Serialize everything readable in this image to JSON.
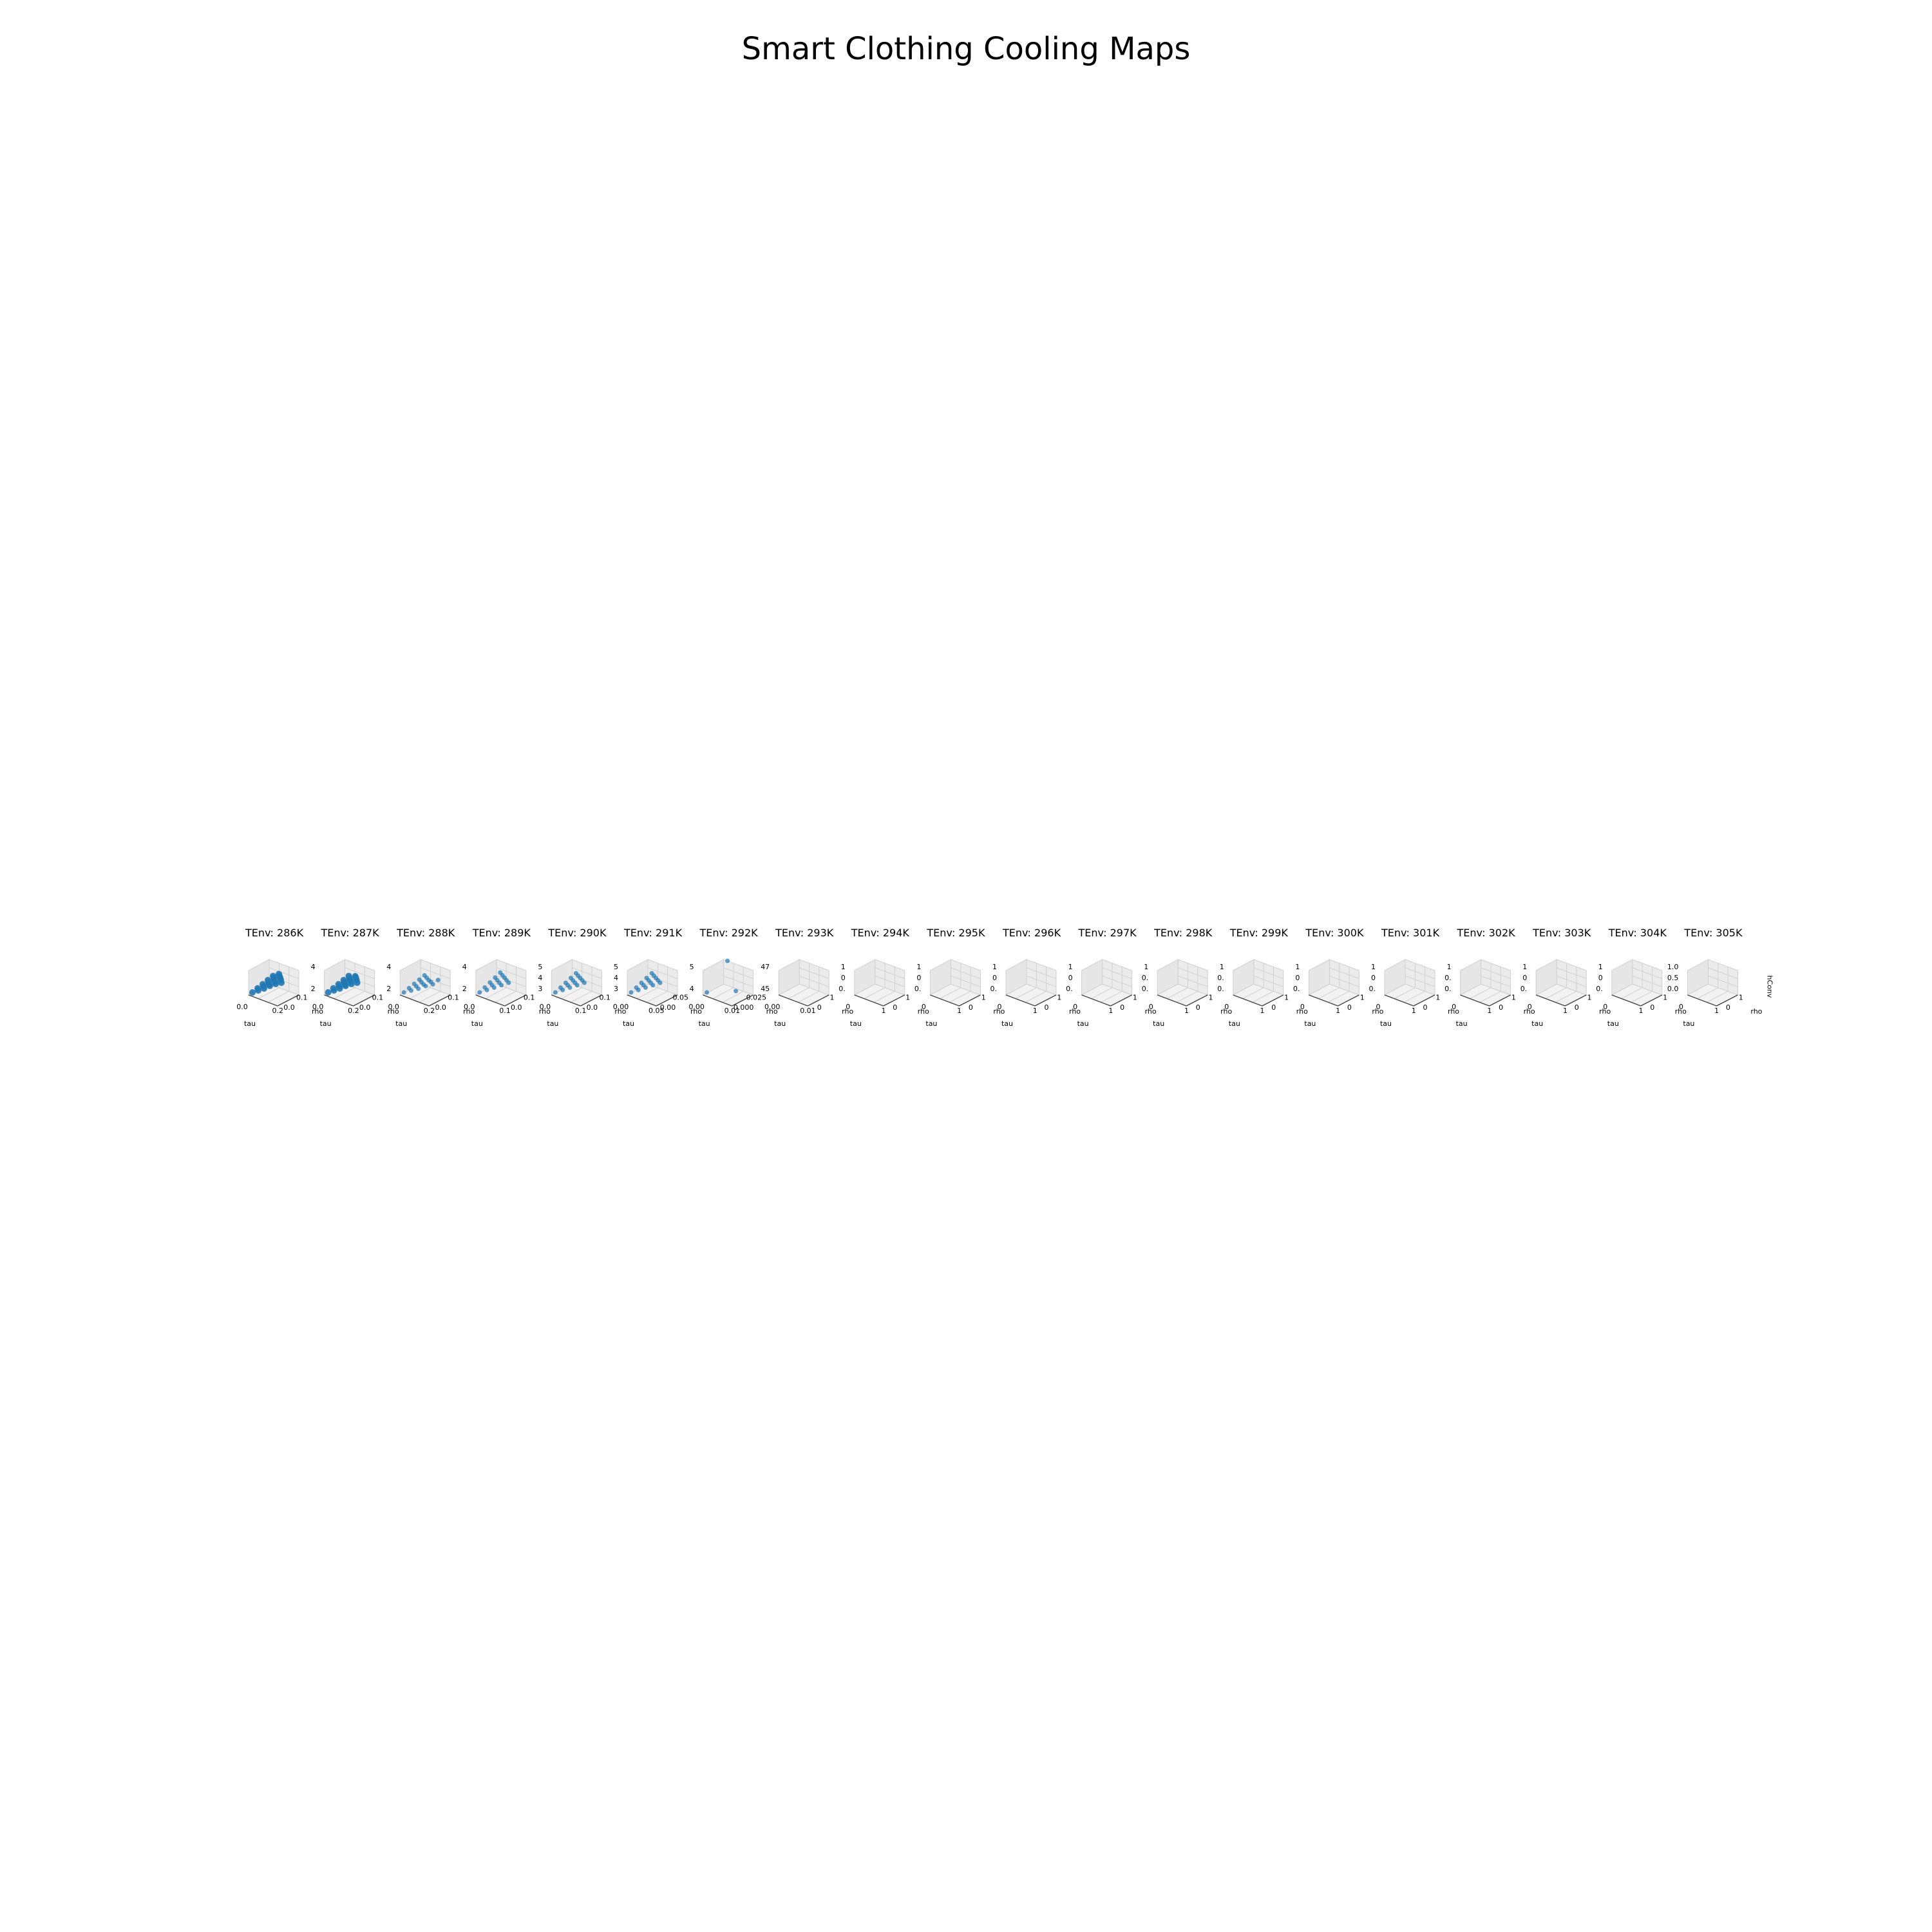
{
  "figure": {
    "title": "Smart Clothing Cooling Maps"
  },
  "style": {
    "point_color": "#1f77b4",
    "pane_color": "#f2f2f2",
    "grid_color": "#d0d0d0"
  },
  "chart_data": [
    {
      "type": "scatter3d",
      "title": "TEnv: 286K",
      "xlabel": "tau",
      "ylabel": "rho",
      "zlabel": "",
      "x_ticks": [
        "0.0",
        "0.2"
      ],
      "y_ticks": [
        "0.0",
        "0.1"
      ],
      "z_ticks": [],
      "has_data": true,
      "points": [
        [
          0.0,
          0.0,
          2.0
        ],
        [
          0.05,
          0.0,
          2.6
        ],
        [
          0.1,
          0.0,
          3.2
        ],
        [
          0.15,
          0.0,
          3.9
        ],
        [
          0.2,
          0.0,
          4.5
        ],
        [
          0.25,
          0.0,
          5.0
        ],
        [
          0.0,
          0.03,
          2.2
        ],
        [
          0.05,
          0.03,
          2.8
        ],
        [
          0.1,
          0.03,
          3.4
        ],
        [
          0.15,
          0.03,
          4.1
        ],
        [
          0.2,
          0.03,
          4.7
        ],
        [
          0.0,
          0.06,
          2.4
        ],
        [
          0.05,
          0.06,
          3.0
        ],
        [
          0.1,
          0.06,
          3.6
        ],
        [
          0.15,
          0.06,
          4.3
        ],
        [
          0.0,
          0.09,
          2.6
        ],
        [
          0.05,
          0.09,
          3.2
        ],
        [
          0.1,
          0.09,
          3.8
        ],
        [
          0.0,
          0.12,
          2.8
        ],
        [
          0.05,
          0.12,
          3.4
        ]
      ]
    },
    {
      "type": "scatter3d",
      "title": "TEnv: 287K",
      "xlabel": "tau",
      "ylabel": "rho",
      "zlabel": "",
      "x_ticks": [
        "0.0",
        "0.2"
      ],
      "y_ticks": [
        "0.0",
        "0.1"
      ],
      "z_ticks": [
        "2",
        "4"
      ],
      "has_data": true,
      "points": [
        [
          0.0,
          0.0,
          2.0
        ],
        [
          0.05,
          0.0,
          2.6
        ],
        [
          0.1,
          0.0,
          3.2
        ],
        [
          0.15,
          0.0,
          3.9
        ],
        [
          0.2,
          0.0,
          4.5
        ],
        [
          0.25,
          0.0,
          5.0
        ],
        [
          0.0,
          0.03,
          2.2
        ],
        [
          0.05,
          0.03,
          2.8
        ],
        [
          0.1,
          0.03,
          3.4
        ],
        [
          0.15,
          0.03,
          4.1
        ],
        [
          0.2,
          0.03,
          4.7
        ],
        [
          0.0,
          0.06,
          2.4
        ],
        [
          0.05,
          0.06,
          3.0
        ],
        [
          0.1,
          0.06,
          3.6
        ],
        [
          0.15,
          0.06,
          4.3
        ],
        [
          0.0,
          0.09,
          2.6
        ],
        [
          0.05,
          0.09,
          3.2
        ],
        [
          0.1,
          0.09,
          3.8
        ],
        [
          0.0,
          0.12,
          2.8
        ]
      ]
    },
    {
      "type": "scatter3d",
      "title": "TEnv: 288K",
      "xlabel": "tau",
      "ylabel": "rho",
      "zlabel": "",
      "x_ticks": [
        "0.0",
        "0.2"
      ],
      "y_ticks": [
        "0.0",
        "0.1"
      ],
      "z_ticks": [
        "2",
        "4"
      ],
      "has_data": true,
      "points": [
        [
          0.0,
          0.0,
          2.0
        ],
        [
          0.05,
          0.0,
          2.6
        ],
        [
          0.1,
          0.0,
          3.2
        ],
        [
          0.15,
          0.0,
          3.9
        ],
        [
          0.2,
          0.0,
          4.5
        ],
        [
          0.0,
          0.03,
          2.2
        ],
        [
          0.05,
          0.03,
          2.8
        ],
        [
          0.1,
          0.03,
          3.4
        ],
        [
          0.15,
          0.03,
          4.1
        ],
        [
          0.2,
          0.03,
          4.7
        ],
        [
          0.0,
          0.06,
          2.4
        ],
        [
          0.05,
          0.06,
          3.0
        ],
        [
          0.1,
          0.06,
          3.6
        ],
        [
          0.0,
          0.09,
          2.6
        ],
        [
          0.05,
          0.09,
          3.2
        ],
        [
          0.0,
          0.12,
          2.8
        ]
      ]
    },
    {
      "type": "scatter3d",
      "title": "TEnv: 289K",
      "xlabel": "tau",
      "ylabel": "rho",
      "zlabel": "",
      "x_ticks": [
        "0.0",
        "0.1"
      ],
      "y_ticks": [
        "0.0",
        "0.1"
      ],
      "z_ticks": [
        "2",
        "4"
      ],
      "has_data": true,
      "points": [
        [
          0.0,
          0.0,
          2.0
        ],
        [
          0.04,
          0.0,
          2.7
        ],
        [
          0.08,
          0.0,
          3.4
        ],
        [
          0.12,
          0.0,
          4.1
        ],
        [
          0.16,
          0.0,
          4.8
        ],
        [
          0.0,
          0.03,
          2.3
        ],
        [
          0.04,
          0.03,
          3.0
        ],
        [
          0.08,
          0.03,
          3.7
        ],
        [
          0.12,
          0.03,
          4.4
        ],
        [
          0.0,
          0.06,
          2.6
        ],
        [
          0.04,
          0.06,
          3.3
        ],
        [
          0.08,
          0.06,
          4.0
        ],
        [
          0.0,
          0.09,
          2.9
        ],
        [
          0.04,
          0.09,
          3.6
        ],
        [
          0.0,
          0.12,
          3.2
        ]
      ]
    },
    {
      "type": "scatter3d",
      "title": "TEnv: 290K",
      "xlabel": "tau",
      "ylabel": "rho",
      "zlabel": "",
      "x_ticks": [
        "0.0",
        "0.1"
      ],
      "y_ticks": [
        "0.0",
        "0.1"
      ],
      "z_ticks": [
        "3",
        "4",
        "5"
      ],
      "has_data": true,
      "points": [
        [
          0.0,
          0.0,
          3.0
        ],
        [
          0.03,
          0.0,
          3.5
        ],
        [
          0.06,
          0.0,
          4.0
        ],
        [
          0.09,
          0.0,
          4.5
        ],
        [
          0.12,
          0.0,
          5.0
        ],
        [
          0.0,
          0.03,
          3.2
        ],
        [
          0.03,
          0.03,
          3.7
        ],
        [
          0.06,
          0.03,
          4.2
        ],
        [
          0.09,
          0.03,
          4.7
        ],
        [
          0.0,
          0.06,
          3.4
        ],
        [
          0.03,
          0.06,
          3.9
        ],
        [
          0.06,
          0.06,
          4.4
        ],
        [
          0.0,
          0.09,
          3.6
        ],
        [
          0.03,
          0.09,
          4.1
        ],
        [
          0.0,
          0.12,
          3.8
        ]
      ]
    },
    {
      "type": "scatter3d",
      "title": "TEnv: 291K",
      "xlabel": "tau",
      "ylabel": "rho",
      "zlabel": "",
      "x_ticks": [
        "0.00",
        "0.05"
      ],
      "y_ticks": [
        "0.00",
        "0.05"
      ],
      "z_ticks": [
        "3",
        "4",
        "5"
      ],
      "has_data": true,
      "points": [
        [
          0.0,
          0.0,
          3.0
        ],
        [
          0.015,
          0.0,
          3.5
        ],
        [
          0.03,
          0.0,
          4.0
        ],
        [
          0.045,
          0.0,
          4.5
        ],
        [
          0.06,
          0.0,
          5.0
        ],
        [
          0.0,
          0.015,
          3.2
        ],
        [
          0.015,
          0.015,
          3.7
        ],
        [
          0.03,
          0.015,
          4.2
        ],
        [
          0.045,
          0.015,
          4.7
        ],
        [
          0.0,
          0.03,
          3.4
        ],
        [
          0.015,
          0.03,
          3.9
        ],
        [
          0.03,
          0.03,
          4.4
        ],
        [
          0.0,
          0.045,
          3.6
        ],
        [
          0.015,
          0.045,
          4.1
        ],
        [
          0.0,
          0.06,
          3.8
        ]
      ]
    },
    {
      "type": "scatter3d",
      "title": "TEnv: 292K",
      "xlabel": "tau",
      "ylabel": "rho",
      "zlabel": "",
      "x_ticks": [
        "0.00",
        "0.01"
      ],
      "y_ticks": [
        "0.000",
        "0.025"
      ],
      "z_ticks": [
        "4",
        "5"
      ],
      "has_data": true,
      "points": [
        [
          0.0,
          0.0,
          4.0
        ],
        [
          0.01,
          0.0,
          4.6
        ],
        [
          0.0,
          0.025,
          5.0
        ]
      ]
    },
    {
      "type": "scatter3d",
      "title": "TEnv: 293K",
      "xlabel": "tau",
      "ylabel": "rho",
      "zlabel": "",
      "x_ticks": [
        "0.00",
        "0.01"
      ],
      "y_ticks": [
        "0",
        "1"
      ],
      "z_ticks": [
        "45",
        "47"
      ],
      "has_data": false,
      "points": []
    },
    {
      "type": "scatter3d",
      "title": "TEnv: 294K",
      "xlabel": "tau",
      "ylabel": "rho",
      "zlabel": "",
      "x_ticks": [
        "0",
        "1"
      ],
      "y_ticks": [
        "0",
        "1"
      ],
      "z_ticks": [
        "0.",
        "0",
        "1"
      ],
      "has_data": false,
      "points": []
    },
    {
      "type": "scatter3d",
      "title": "TEnv: 295K",
      "xlabel": "tau",
      "ylabel": "rho",
      "zlabel": "",
      "x_ticks": [
        "0",
        "1"
      ],
      "y_ticks": [
        "0",
        "1"
      ],
      "z_ticks": [
        "0.",
        "0",
        "1"
      ],
      "has_data": false,
      "points": []
    },
    {
      "type": "scatter3d",
      "title": "TEnv: 296K",
      "xlabel": "tau",
      "ylabel": "rho",
      "zlabel": "",
      "x_ticks": [
        "0",
        "1"
      ],
      "y_ticks": [
        "0",
        "1"
      ],
      "z_ticks": [
        "0.",
        "0",
        "1"
      ],
      "has_data": false,
      "points": []
    },
    {
      "type": "scatter3d",
      "title": "TEnv: 297K",
      "xlabel": "tau",
      "ylabel": "rho",
      "zlabel": "",
      "x_ticks": [
        "0",
        "1"
      ],
      "y_ticks": [
        "0",
        "1"
      ],
      "z_ticks": [
        "0.",
        "0",
        "1"
      ],
      "has_data": false,
      "points": []
    },
    {
      "type": "scatter3d",
      "title": "TEnv: 298K",
      "xlabel": "tau",
      "ylabel": "rho",
      "zlabel": "",
      "x_ticks": [
        "0",
        "1"
      ],
      "y_ticks": [
        "0",
        "1"
      ],
      "z_ticks": [
        "0.",
        "0.",
        "1"
      ],
      "has_data": false,
      "points": []
    },
    {
      "type": "scatter3d",
      "title": "TEnv: 299K",
      "xlabel": "tau",
      "ylabel": "rho",
      "zlabel": "",
      "x_ticks": [
        "0",
        "1"
      ],
      "y_ticks": [
        "0",
        "1"
      ],
      "z_ticks": [
        "0.",
        "0.",
        "1"
      ],
      "has_data": false,
      "points": []
    },
    {
      "type": "scatter3d",
      "title": "TEnv: 300K",
      "xlabel": "tau",
      "ylabel": "rho",
      "zlabel": "",
      "x_ticks": [
        "0",
        "1"
      ],
      "y_ticks": [
        "0",
        "1"
      ],
      "z_ticks": [
        "0.",
        "0",
        "1"
      ],
      "has_data": false,
      "points": []
    },
    {
      "type": "scatter3d",
      "title": "TEnv: 301K",
      "xlabel": "tau",
      "ylabel": "rho",
      "zlabel": "",
      "x_ticks": [
        "0",
        "1"
      ],
      "y_ticks": [
        "0",
        "1"
      ],
      "z_ticks": [
        "0.",
        "0",
        "1"
      ],
      "has_data": false,
      "points": []
    },
    {
      "type": "scatter3d",
      "title": "TEnv: 302K",
      "xlabel": "tau",
      "ylabel": "rho",
      "zlabel": "",
      "x_ticks": [
        "0",
        "1"
      ],
      "y_ticks": [
        "0",
        "1"
      ],
      "z_ticks": [
        "0.",
        "0.",
        "1"
      ],
      "has_data": false,
      "points": []
    },
    {
      "type": "scatter3d",
      "title": "TEnv: 303K",
      "xlabel": "tau",
      "ylabel": "rho",
      "zlabel": "",
      "x_ticks": [
        "0",
        "1"
      ],
      "y_ticks": [
        "0",
        "1"
      ],
      "z_ticks": [
        "0.",
        "0",
        "1"
      ],
      "has_data": false,
      "points": []
    },
    {
      "type": "scatter3d",
      "title": "TEnv: 304K",
      "xlabel": "tau",
      "ylabel": "rho",
      "zlabel": "",
      "x_ticks": [
        "0",
        "1"
      ],
      "y_ticks": [
        "0",
        "1"
      ],
      "z_ticks": [
        "0.",
        "0",
        "1"
      ],
      "has_data": false,
      "points": []
    },
    {
      "type": "scatter3d",
      "title": "TEnv: 305K",
      "xlabel": "tau",
      "ylabel": "rho",
      "zlabel": "hConv",
      "x_ticks": [
        "0",
        "1"
      ],
      "y_ticks": [
        "0",
        "1"
      ],
      "z_ticks": [
        "0.0",
        "0.5",
        "1.0"
      ],
      "has_data": false,
      "points": []
    }
  ]
}
